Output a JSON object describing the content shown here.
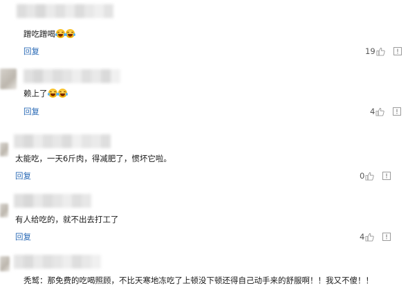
{
  "comments": [
    {
      "text": "蹭吃蹭喝",
      "emoji_icons": [
        "cry-laugh-icon",
        "cry-laugh-icon"
      ],
      "reply_label": "回复",
      "likes": "19"
    },
    {
      "text": "赖上了",
      "emoji_icons": [
        "cry-laugh-icon",
        "cry-laugh-icon"
      ],
      "reply_label": "回复",
      "likes": "4"
    },
    {
      "text": "太能吃，一天6斤肉，得减肥了，惯坏它啦。",
      "reply_label": "回复",
      "likes": "0"
    },
    {
      "text": "有人给吃的，就不出去打工了",
      "reply_label": "回复",
      "likes": "4"
    },
    {
      "text": "秃鹫：那免费的吃喝照顾，不比天寒地冻吃了上顿没下顿还得自己动手来的舒服啊！！我又不傻！！"
    }
  ],
  "colors": {
    "link": "#2b6bb6",
    "count": "#555555",
    "icon_gray": "#9a9a9a"
  }
}
